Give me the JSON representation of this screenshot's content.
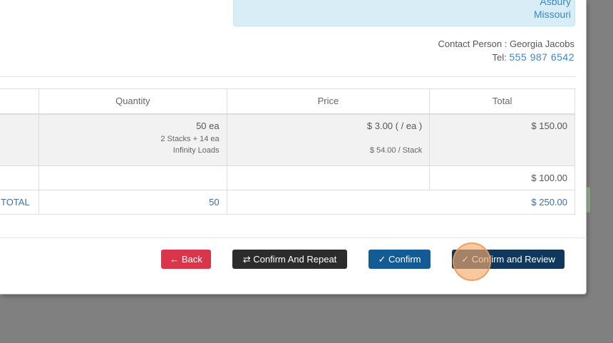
{
  "address": {
    "line1": "Asbury",
    "line2": "Missouri"
  },
  "contact": {
    "label": "Contact Person",
    "name": "Georgia Jacobs",
    "tel_label": "Tel:",
    "tel": "555 987 6542"
  },
  "table": {
    "headers": [
      "",
      "Quantity",
      "Price",
      "Total"
    ],
    "rows": [
      {
        "qty": "50 ea",
        "qty_detail": "2 Stacks + 14 ea",
        "qty_company": "Infinity Loads",
        "price": "$ 3.00 ( / ea )",
        "price_stack": "$ 54.00 / Stack",
        "total": "$ 150.00"
      },
      {
        "total": "$ 100.00"
      }
    ],
    "total_row": {
      "label": "TOTAL",
      "qty": "50",
      "total": "$ 250.00"
    }
  },
  "buttons": {
    "back": "Back",
    "repeat": "Confirm And Repeat",
    "confirm": "Confirm",
    "review": "Confirm and Review"
  },
  "icons": {
    "back": "arrow-left-icon",
    "repeat": "refresh-icon",
    "confirm": "check-icon",
    "review": "check-icon"
  }
}
